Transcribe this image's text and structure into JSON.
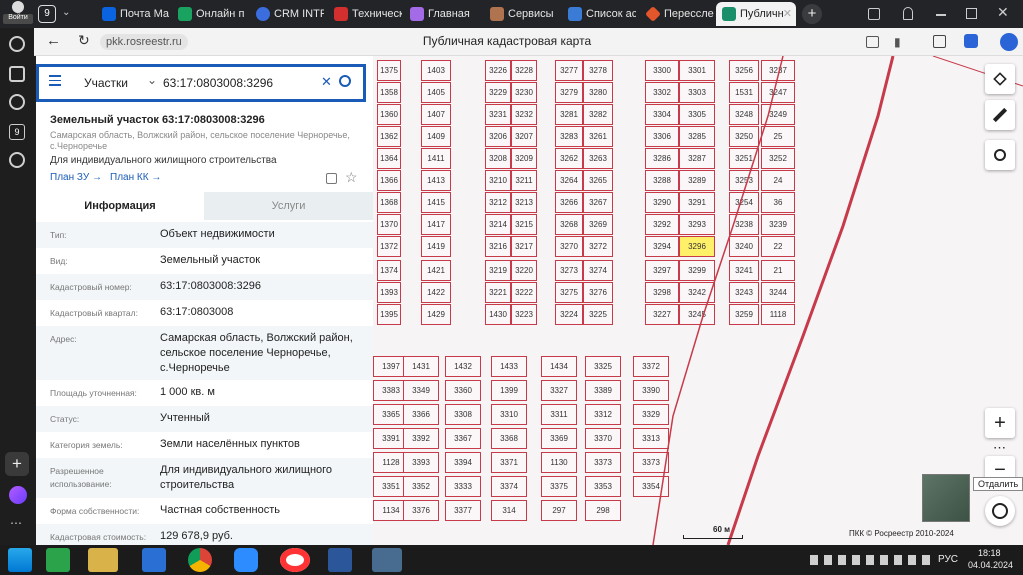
{
  "tabbar": {
    "tabs": [
      {
        "label": "Почта Ма",
        "color": "#0a63e0"
      },
      {
        "label": "Онлайн п",
        "color": "#1aa260"
      },
      {
        "label": "CRM INTF",
        "color": "#3b6dde"
      },
      {
        "label": "Техническ",
        "color": "#d32f2f"
      },
      {
        "label": "Главная",
        "color": "#a36be5"
      },
      {
        "label": "Сервисы",
        "color": "#b0734f"
      },
      {
        "label": "Список ас",
        "color": "#3a7bd5"
      },
      {
        "label": "Пересслен",
        "color": "#e3562c"
      },
      {
        "label": "Публичн",
        "color": "#1a8f6a"
      }
    ],
    "counter": "9",
    "login_label": "Войти"
  },
  "addressbar": {
    "url": "pkk.rosreestr.ru",
    "page_title": "Публичная кадастровая карта"
  },
  "sidebar": {
    "badge": "9"
  },
  "panel": {
    "search": {
      "category": "Участки",
      "query": "63:17:0803008:3296"
    },
    "title": "Земельный участок 63:17:0803008:3296",
    "address_short": "Самарская область, Волжский район, сельское поселение Черноречье, с.Черноречье",
    "purpose": "Для индивидуального жилищного строительства",
    "links": [
      "План ЗУ →",
      "План КК →"
    ],
    "tabs": [
      "Информация",
      "Услуги"
    ],
    "rows": [
      {
        "key": "Тип:",
        "value": "Объект недвижимости"
      },
      {
        "key": "Вид:",
        "value": "Земельный участок"
      },
      {
        "key": "Кадастровый номер:",
        "value": "63:17:0803008:3296"
      },
      {
        "key": "Кадастровый квартал:",
        "value": "63:17:0803008"
      },
      {
        "key": "Адрес:",
        "value": "Самарская область, Волжский район, сельское поселение Черноречье, с.Черноречье"
      },
      {
        "key": "Площадь уточненная:",
        "value": "1 000 кв. м"
      },
      {
        "key": "Статус:",
        "value": "Учтенный"
      },
      {
        "key": "Категория земель:",
        "value": "Земли населённых пунктов"
      },
      {
        "key": "Разрешенное использование:",
        "value": "Для индивидуального жилищного строительства"
      },
      {
        "key": "Форма собственности:",
        "value": "Частная собственность"
      },
      {
        "key": "Кадастровая стоимость:",
        "value": "129 678,9 руб."
      }
    ]
  },
  "map": {
    "scale_label": "60 м",
    "copyright": "ПКК © Росреестр 2010-2024",
    "zoom_out_tooltip": "Отдалить",
    "highlight_color": "#fff06a",
    "boundary_color": "#c63a49",
    "parcels": [
      "1375",
      "1403",
      "3226",
      "3228",
      "3277",
      "3278",
      "3300",
      "3301",
      "3256",
      "3237",
      "1358",
      "1405",
      "3229",
      "3230",
      "3279",
      "3280",
      "3302",
      "3303",
      "1531",
      "3247",
      "1360",
      "1407",
      "3231",
      "3232",
      "3281",
      "3282",
      "3304",
      "3305",
      "3248",
      "3249",
      "1362",
      "1409",
      "3206",
      "3207",
      "3283",
      "3261",
      "3306",
      "3285",
      "3250",
      "25",
      "1364",
      "1411",
      "3208",
      "3209",
      "3262",
      "3263",
      "3286",
      "3287",
      "3251",
      "3252",
      "1366",
      "1413",
      "3210",
      "3211",
      "3264",
      "3265",
      "3288",
      "3289",
      "3253",
      "24",
      "1368",
      "1415",
      "3212",
      "3213",
      "3266",
      "3267",
      "3290",
      "3291",
      "3254",
      "36",
      "1370",
      "1417",
      "3214",
      "3215",
      "3268",
      "3269",
      "3292",
      "3293",
      "3238",
      "3239",
      "1372",
      "1419",
      "3216",
      "3217",
      "3270",
      "3272",
      "3294",
      "3296",
      "3240",
      "22",
      "1374",
      "1421",
      "3219",
      "3220",
      "3273",
      "3274",
      "3297",
      "3299",
      "3241",
      "21",
      "1393",
      "1422",
      "3221",
      "3222",
      "3275",
      "3276",
      "3298",
      "3242",
      "3243",
      "3244",
      "1395",
      "1429",
      "1430",
      "3223",
      "3224",
      "3225",
      "3227",
      "3245",
      "3259",
      "1118",
      "1397",
      "1431",
      "1432",
      "1433",
      "1434",
      "3325",
      "3372",
      "3383",
      "3349",
      "3360",
      "1399",
      "3327",
      "3389",
      "3390",
      "3365",
      "3366",
      "3308",
      "3310",
      "3311",
      "3312",
      "3329",
      "3391",
      "3392",
      "3367",
      "3368",
      "3369",
      "3370",
      "3313",
      "1128",
      "3393",
      "3394",
      "3371",
      "1130",
      "3373",
      "3373",
      "3351",
      "3352",
      "3333",
      "3374",
      "3375",
      "3353",
      "3354",
      "1134",
      "3376",
      "3377",
      "314",
      "297",
      "298"
    ]
  },
  "taskbar": {
    "time": "18:18",
    "date": "04.04.2024",
    "lang": "РУС"
  }
}
